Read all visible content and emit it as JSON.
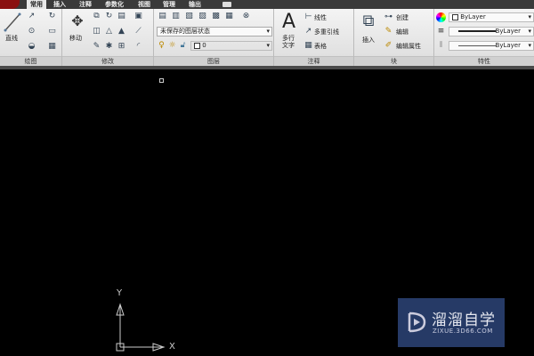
{
  "tabs": [
    "常用",
    "插入",
    "注释",
    "参数化",
    "视图",
    "管理",
    "输出"
  ],
  "panels": {
    "draw": "绘图",
    "modify": "修改",
    "layer": "图层",
    "annotate": "注释",
    "block": "块",
    "properties": "特性"
  },
  "draw": {
    "line": "直线"
  },
  "modify": {
    "move": "移动"
  },
  "layer": {
    "state": "未保存的图层状态",
    "current": "0"
  },
  "annotate": {
    "mtext_icon": "A",
    "mtext": "多行文字",
    "linear": "线性",
    "mleader": "多重引线",
    "table": "表格"
  },
  "block": {
    "insert": "插入",
    "create": "创建",
    "edit": "编辑",
    "edit_attr": "编辑属性"
  },
  "properties": {
    "color": "ByLayer",
    "linetype": "ByLayer",
    "lineweight": "ByLayer"
  },
  "ucs": {
    "x": "X",
    "y": "Y"
  },
  "watermark": {
    "name": "溜溜自学",
    "url": "ZIXUE.3D66.COM"
  }
}
